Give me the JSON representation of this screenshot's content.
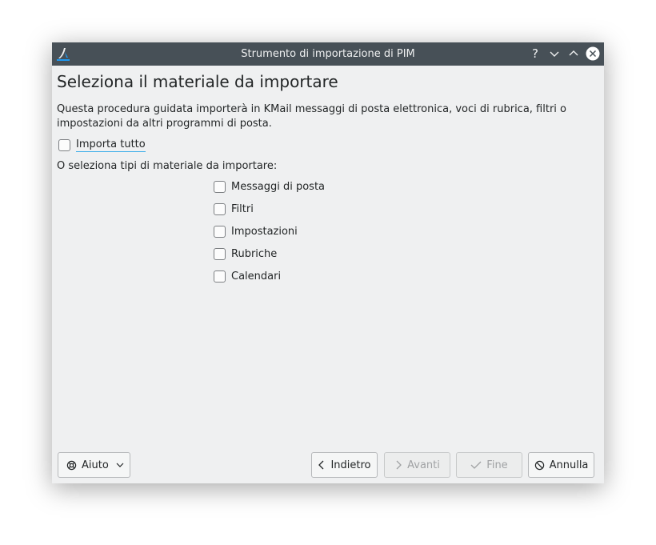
{
  "window": {
    "title": "Strumento di importazione di PIM",
    "titlebar_buttons": {
      "help": "help-icon",
      "minimize": "minimize-icon",
      "maximize": "maximize-icon",
      "close": "close-icon"
    }
  },
  "page": {
    "heading": "Seleziona il materiale da importare",
    "description": "Questa procedura guidata importerà in KMail messaggi di posta elettronica, voci di rubrica, filtri o impostazioni da altri programmi di posta.",
    "import_all_label": "Importa tutto",
    "or_select_label": "O seleziona tipi di materiale da importare:",
    "options": [
      {
        "label": "Messaggi di posta",
        "checked": false
      },
      {
        "label": "Filtri",
        "checked": false
      },
      {
        "label": "Impostazioni",
        "checked": false
      },
      {
        "label": "Rubriche",
        "checked": false
      },
      {
        "label": "Calendari",
        "checked": false
      }
    ]
  },
  "buttons": {
    "help": "Aiuto",
    "back": "Indietro",
    "next": "Avanti",
    "finish": "Fine",
    "cancel": "Annulla"
  },
  "colors": {
    "titlebar": "#475057",
    "window_bg": "#eff0f1",
    "focus_accent": "#3daee9"
  }
}
